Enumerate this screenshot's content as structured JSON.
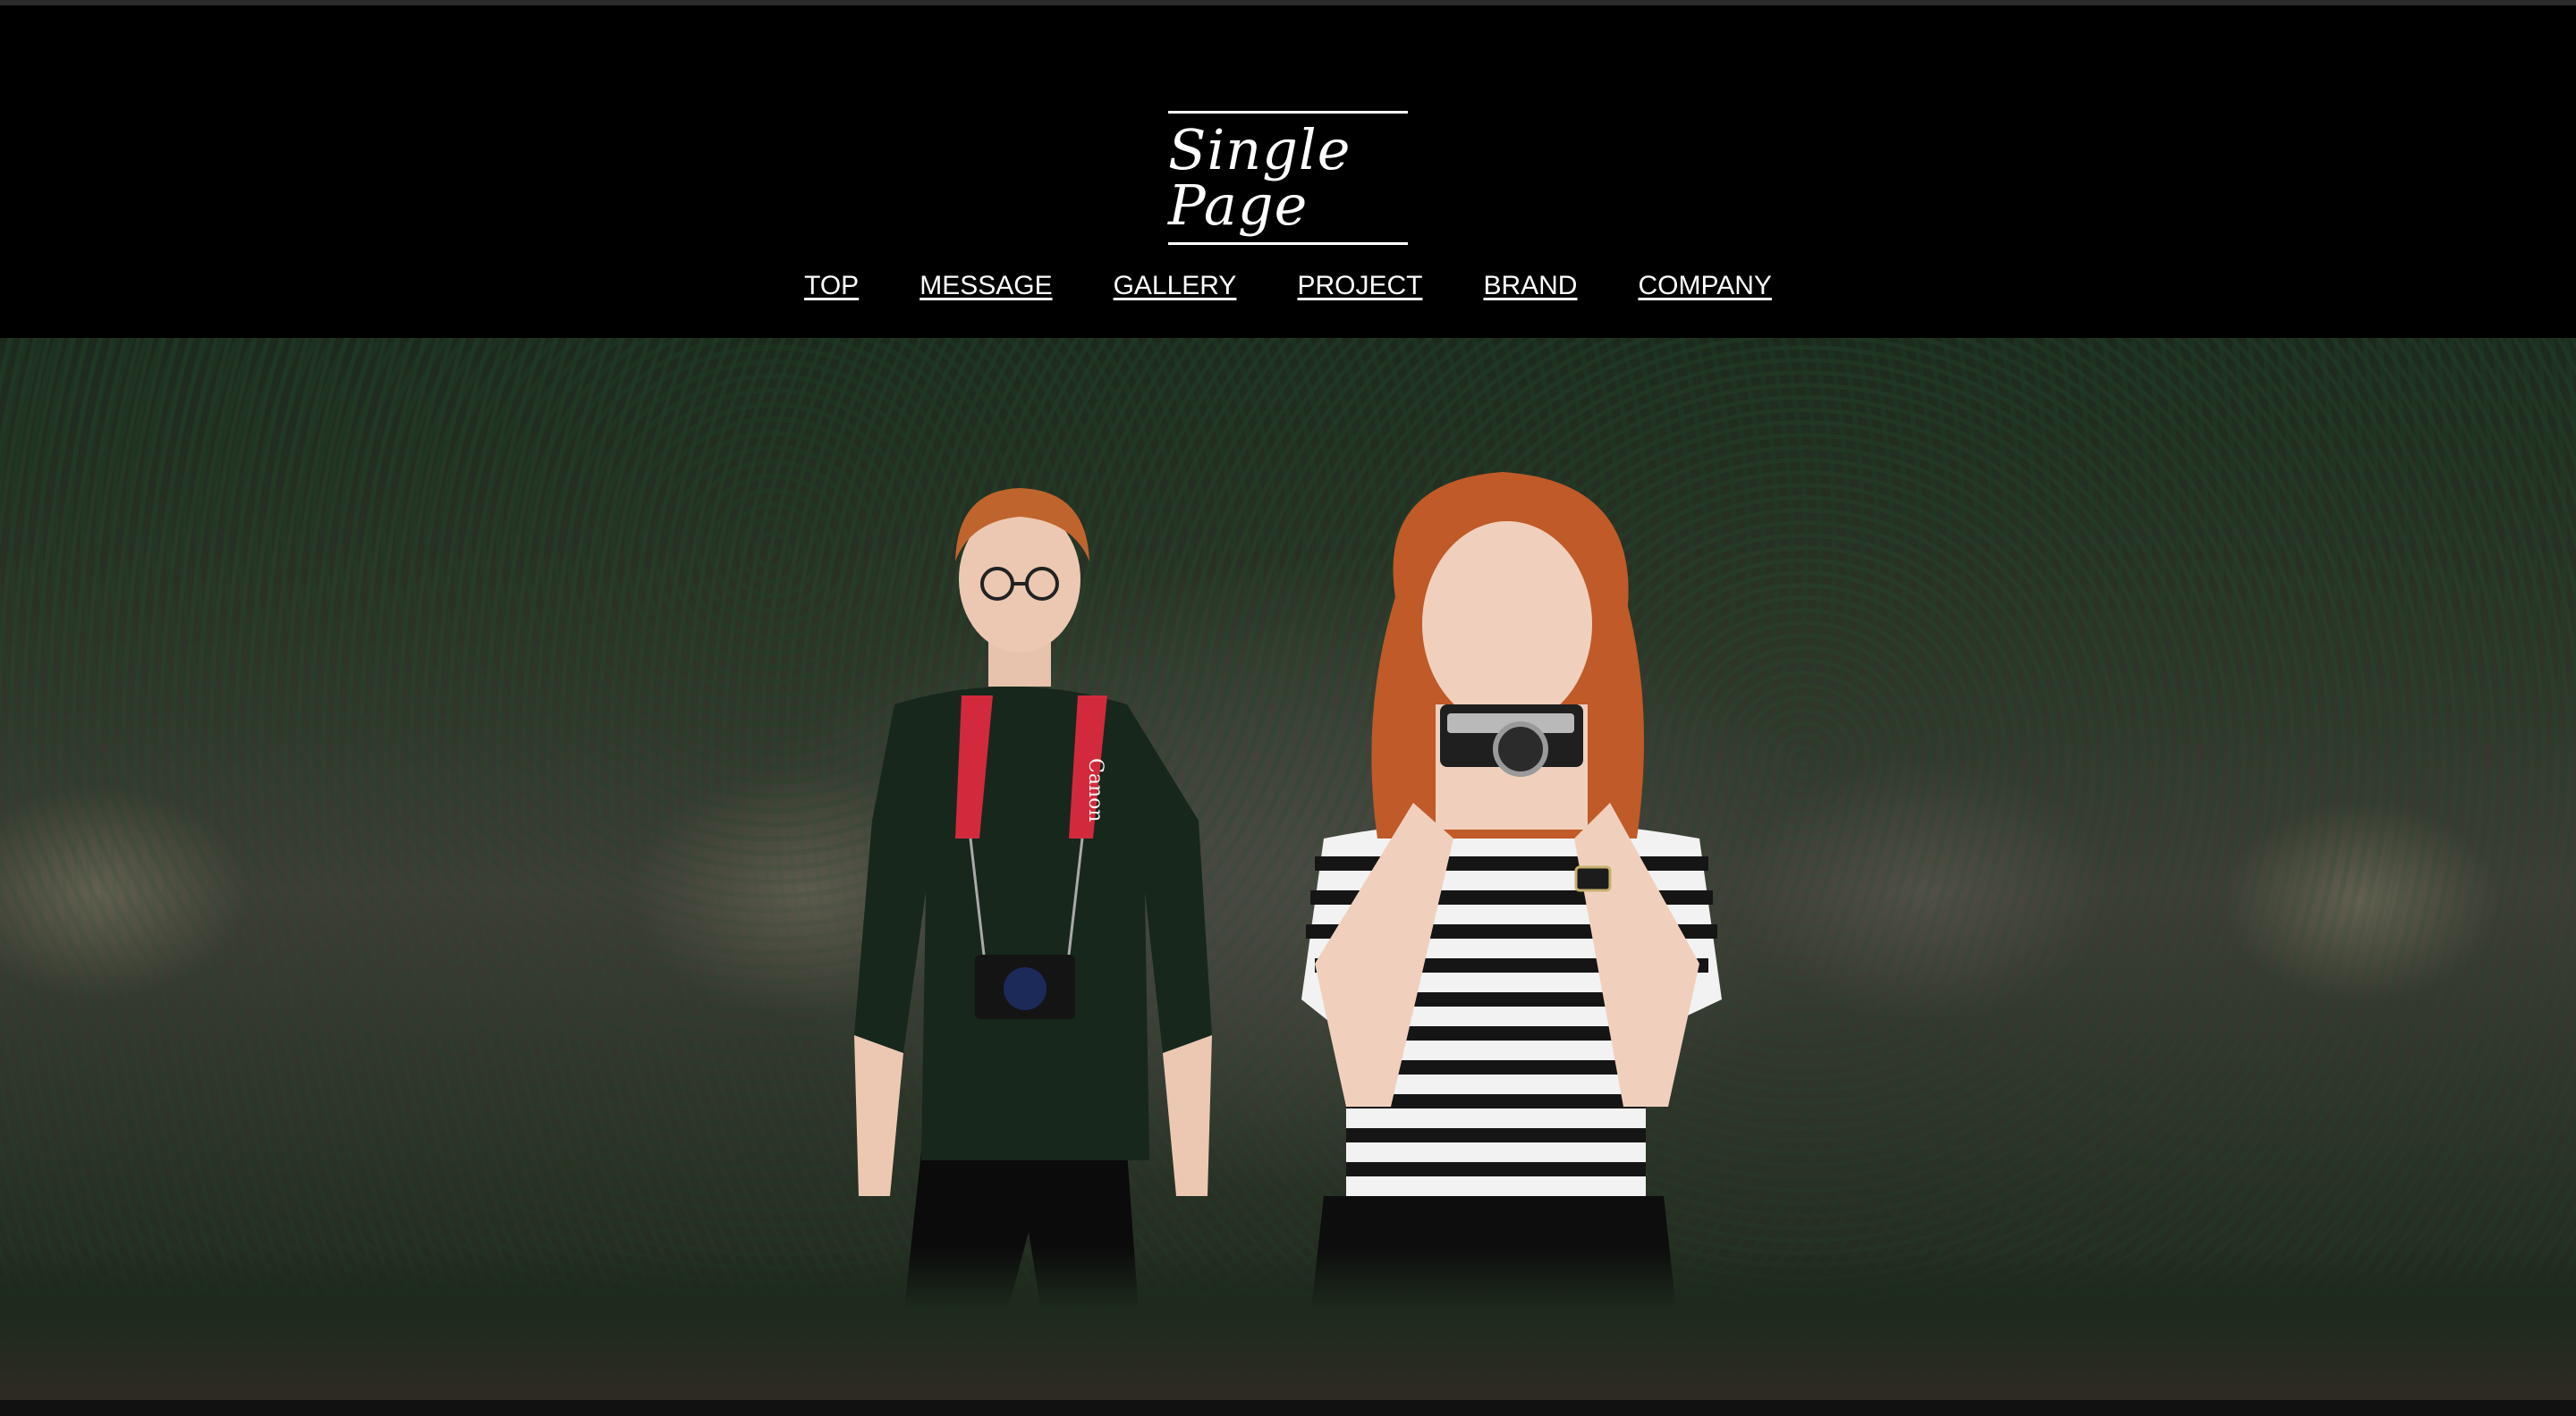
{
  "header": {
    "logo_text": "Single Page"
  },
  "nav": {
    "items": [
      {
        "label": "TOP"
      },
      {
        "label": "MESSAGE"
      },
      {
        "label": "GALLERY"
      },
      {
        "label": "PROJECT"
      },
      {
        "label": "BRAND"
      },
      {
        "label": "COMPANY"
      }
    ]
  },
  "hero": {
    "image_description": "",
    "strap_text": "Canon"
  },
  "colors": {
    "background": "#000000",
    "nav_text": "#ffffff",
    "strap_red": "#d22a3c"
  }
}
